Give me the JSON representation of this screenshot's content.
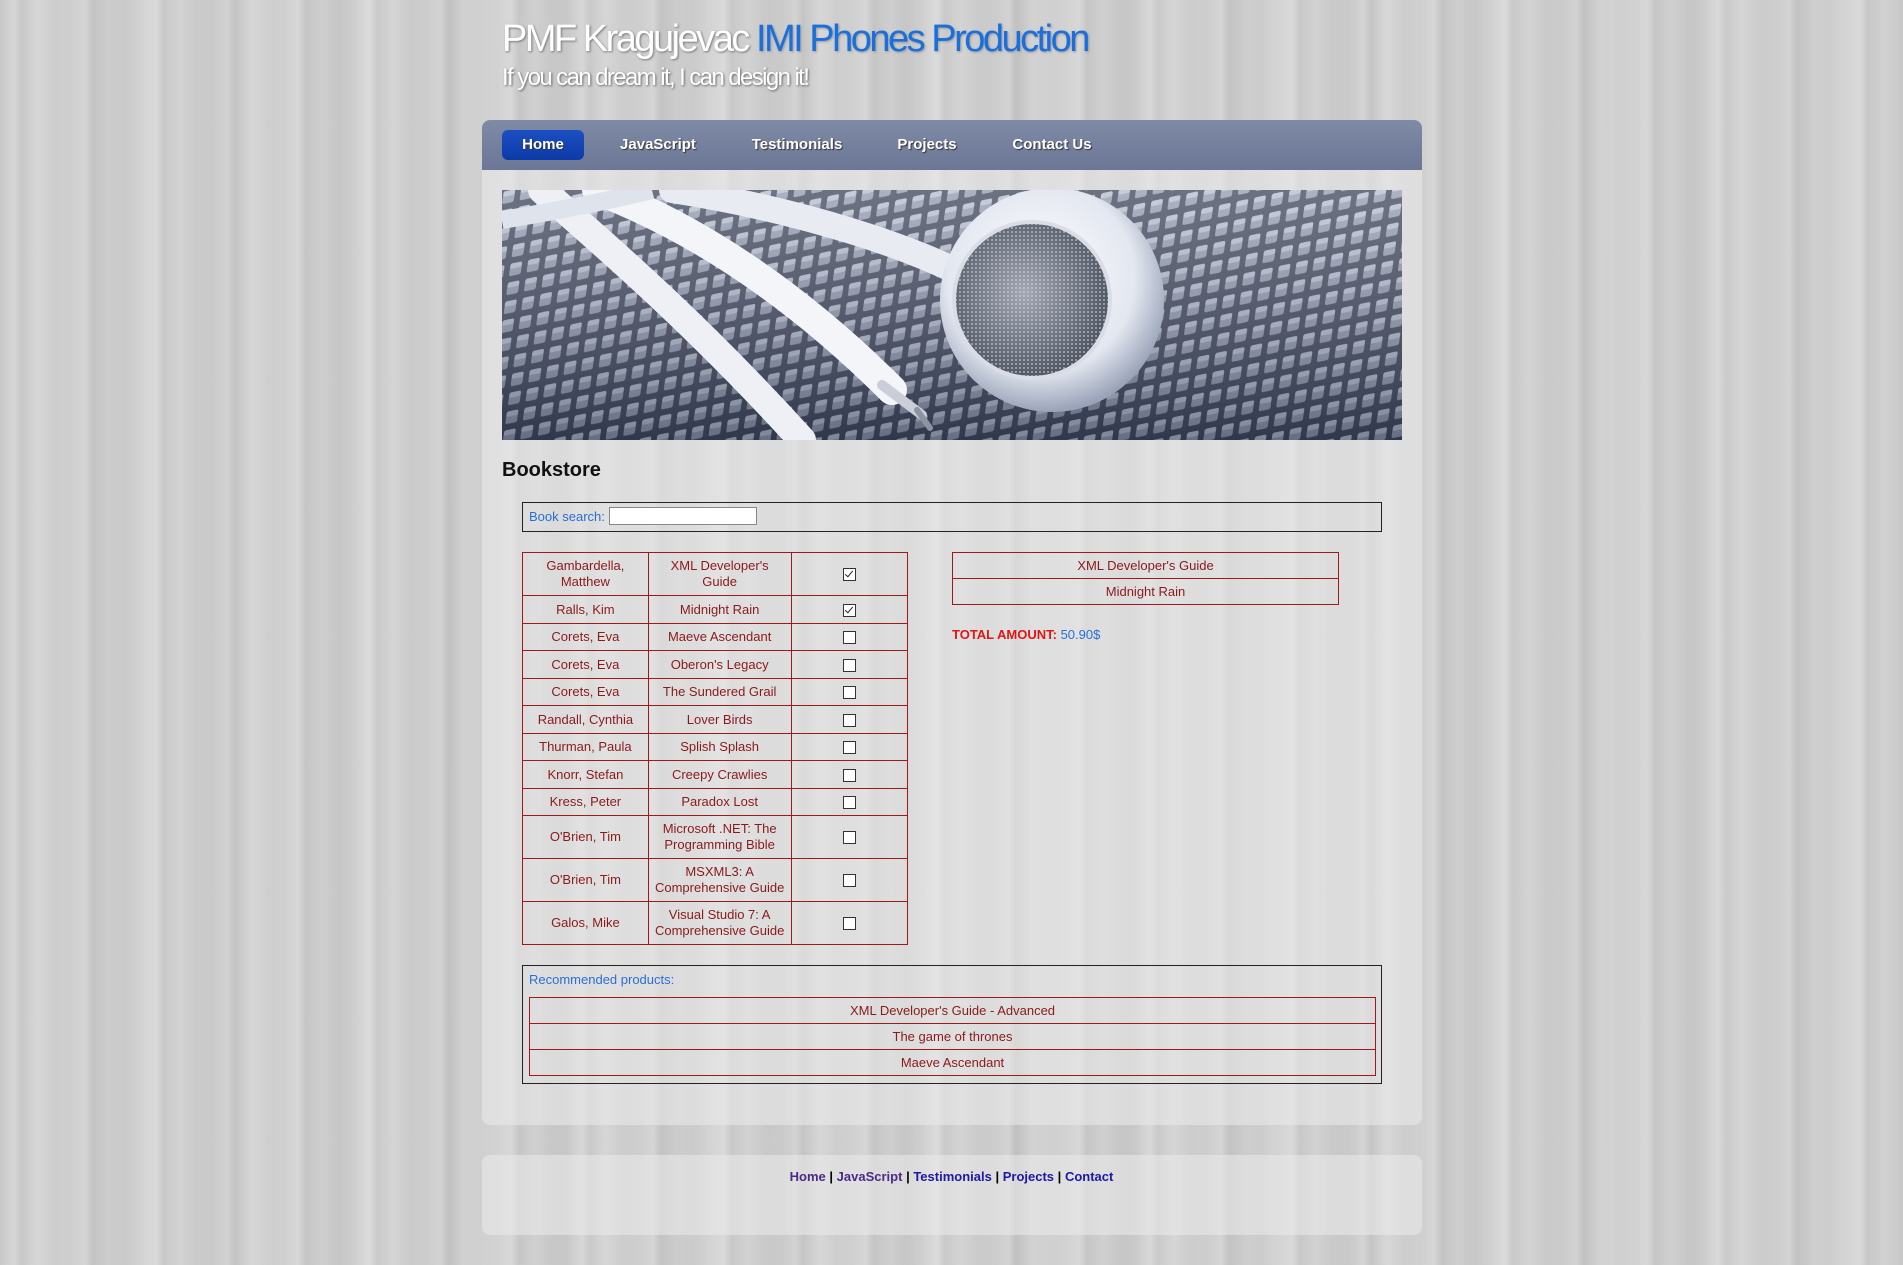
{
  "header": {
    "title_main": "PMF Kragujevac",
    "title_accent": "IMI Phones Production",
    "slogan": "If you can dream it, I can design it!"
  },
  "nav": {
    "items": [
      {
        "label": "Home",
        "active": true
      },
      {
        "label": "JavaScript",
        "active": false
      },
      {
        "label": "Testimonials",
        "active": false
      },
      {
        "label": "Projects",
        "active": false
      },
      {
        "label": "Contact Us",
        "active": false
      }
    ]
  },
  "banner": {
    "icon": "earphones-photo"
  },
  "page": {
    "heading": "Bookstore"
  },
  "search": {
    "label": "Book search:",
    "value": "",
    "placeholder": ""
  },
  "catalog": {
    "rows": [
      {
        "author": "Gambardella, Matthew",
        "title": "XML Developer's Guide",
        "checked": true
      },
      {
        "author": "Ralls, Kim",
        "title": "Midnight Rain",
        "checked": true
      },
      {
        "author": "Corets, Eva",
        "title": "Maeve Ascendant",
        "checked": false
      },
      {
        "author": "Corets, Eva",
        "title": "Oberon's Legacy",
        "checked": false
      },
      {
        "author": "Corets, Eva",
        "title": "The Sundered Grail",
        "checked": false
      },
      {
        "author": "Randall, Cynthia",
        "title": "Lover Birds",
        "checked": false
      },
      {
        "author": "Thurman, Paula",
        "title": "Splish Splash",
        "checked": false
      },
      {
        "author": "Knorr, Stefan",
        "title": "Creepy Crawlies",
        "checked": false
      },
      {
        "author": "Kress, Peter",
        "title": "Paradox Lost",
        "checked": false
      },
      {
        "author": "O'Brien, Tim",
        "title": "Microsoft .NET: The Programming Bible",
        "checked": false
      },
      {
        "author": "O'Brien, Tim",
        "title": "MSXML3: A Comprehensive Guide",
        "checked": false
      },
      {
        "author": "Galos, Mike",
        "title": "Visual Studio 7: A Comprehensive Guide",
        "checked": false
      }
    ]
  },
  "cart": {
    "items": [
      "XML Developer's Guide",
      "Midnight Rain"
    ],
    "total_label": "TOTAL AMOUNT:",
    "total_value": "50.90$"
  },
  "recommended": {
    "label": "Recommended products:",
    "items": [
      "XML Developer's Guide - Advanced",
      "The game of thrones",
      "Maeve Ascendant"
    ]
  },
  "footer": {
    "links": [
      "Home",
      "JavaScript",
      "Testimonials",
      "Projects",
      "Contact"
    ],
    "separator": "|"
  },
  "colors": {
    "nav_bar": "#6f7b99",
    "nav_active": "#1446b8",
    "table_border": "#a01818",
    "table_text": "#8b1a1a",
    "label_blue": "#2a6fd6",
    "total_red": "#e01515"
  }
}
